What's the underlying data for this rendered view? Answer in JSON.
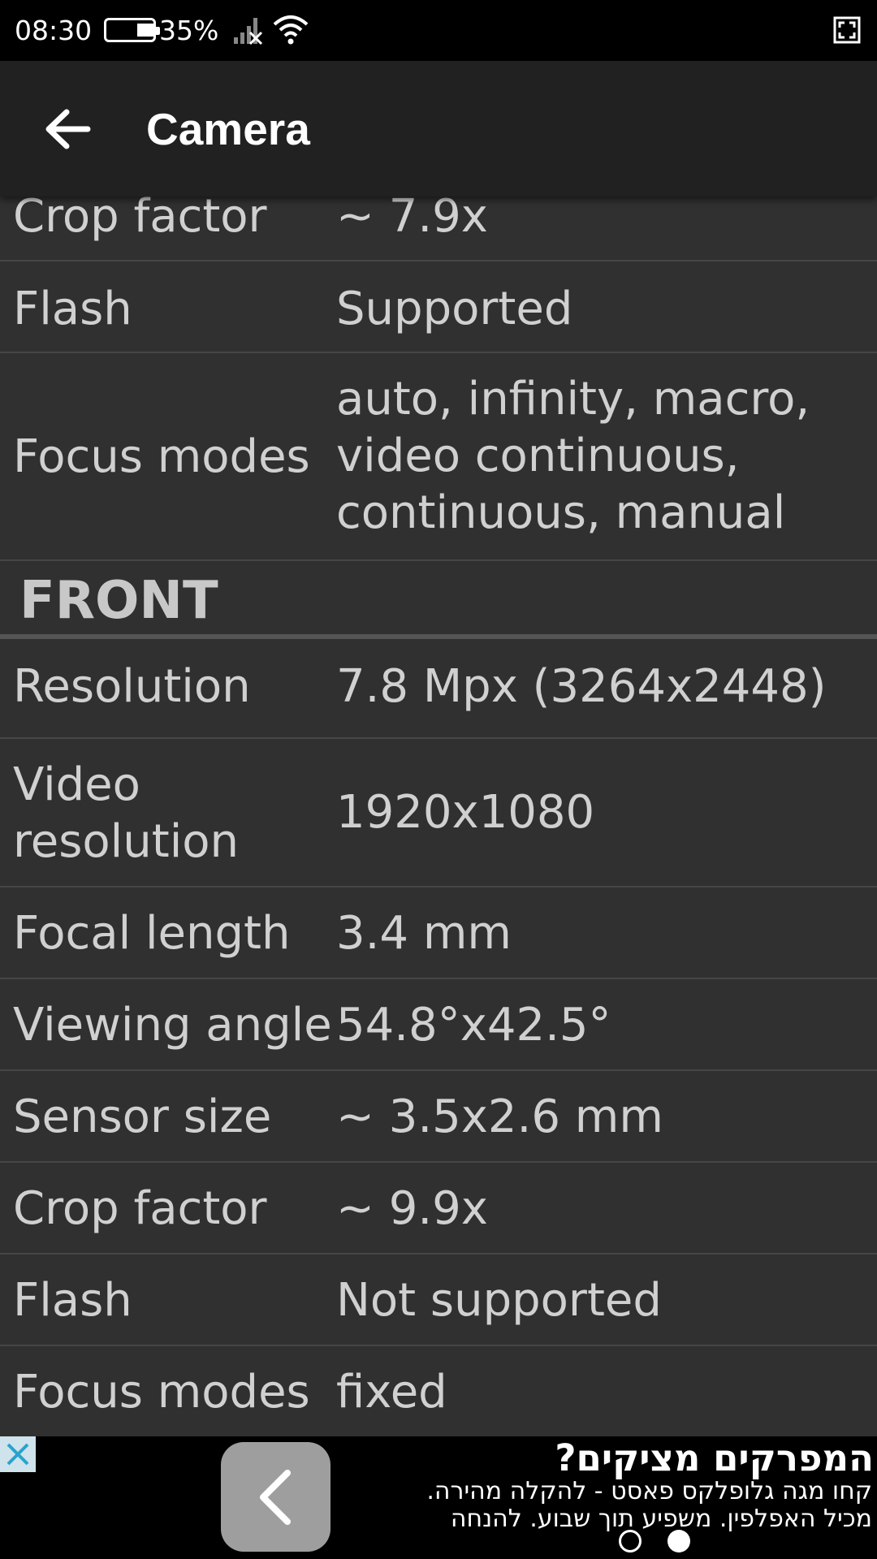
{
  "status_bar": {
    "time": "08:30",
    "battery_percent": "35%",
    "icons": [
      "battery-icon",
      "signal-icon",
      "wifi-icon",
      "fullscreen-icon"
    ]
  },
  "app_bar": {
    "title": "Camera",
    "back_icon": "arrow-left-icon"
  },
  "rear_tail": [
    {
      "label": "Crop factor",
      "value": "~ 7.9x"
    },
    {
      "label": "Flash",
      "value": "Supported"
    },
    {
      "label": "Focus modes",
      "value": "auto, infinity, macro, video continuous, continuous, manual"
    }
  ],
  "front": {
    "header": "FRONT",
    "rows": [
      {
        "label": "Resolution",
        "value": "7.8 Mpx (3264x2448)"
      },
      {
        "label": "Video resolution",
        "value": "1920x1080"
      },
      {
        "label": "Focal length",
        "value": "3.4 mm"
      },
      {
        "label": "Viewing angle",
        "value": "54.8°x42.5°"
      },
      {
        "label": "Sensor size",
        "value": "~ 3.5x2.6 mm"
      },
      {
        "label": "Crop factor",
        "value": "~ 9.9x"
      },
      {
        "label": "Flash",
        "value": "Not supported"
      },
      {
        "label": "Focus modes",
        "value": "fixed"
      }
    ]
  },
  "ad": {
    "title": "המפרקים מציקים?",
    "line1": "קחו מגה גלופלקס פאסט - להקלה מהירה.",
    "line2": "מכיל האפלפין. משפיע תוך שבוע. להנחה",
    "close_icon": "close-icon",
    "nav_icon": "chevron-left-icon",
    "page_dots": 2,
    "active_dot": 2
  },
  "colors": {
    "background": "#303030",
    "app_bar": "#212121",
    "divider": "#464646",
    "text": "#d0d0d0"
  }
}
